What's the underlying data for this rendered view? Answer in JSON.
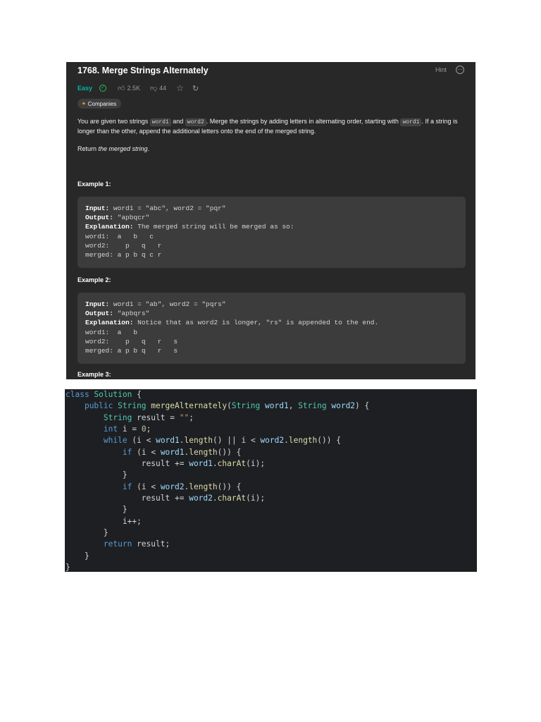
{
  "problem": {
    "title": "1768. Merge Strings Alternately",
    "hint": "Hint",
    "difficulty": "Easy",
    "likes": "2.5K",
    "dislikes": "44",
    "companies": "Companies",
    "desc_1": "You are given two strings ",
    "word1": "word1",
    "desc_2": " and ",
    "word2": "word2",
    "desc_3": ". Merge the strings by adding letters in alternating order, starting with ",
    "desc_4": ". If a string is longer than the other, append the additional letters onto the end of the merged string.",
    "return_prefix": "Return ",
    "return_em": "the merged string",
    "return_suffix": ".",
    "examples": [
      {
        "title": "Example 1:",
        "input_label": "Input:",
        "input": " word1 = \"abc\", word2 = \"pqr\"",
        "output_label": "Output:",
        "output": " \"apbqcr\"",
        "explanation_label": "Explanation:",
        "explanation": " The merged string will be merged as so:",
        "line1": "word1:  a   b   c",
        "line2": "word2:    p   q   r",
        "line3": "merged: a p b q c r"
      },
      {
        "title": "Example 2:",
        "input_label": "Input:",
        "input": " word1 = \"ab\", word2 = \"pqrs\"",
        "output_label": "Output:",
        "output": " \"apbqrs\"",
        "explanation_label": "Explanation:",
        "explanation": " Notice that as word2 is longer, \"rs\" is appended to the end.",
        "line1": "word1:  a   b",
        "line2": "word2:    p   q   r   s",
        "line3": "merged: a p b q   r   s"
      },
      {
        "title": "Example 3:"
      }
    ]
  },
  "code": {
    "language": "Java",
    "lines": [
      "class Solution {",
      "    public String mergeAlternately(String word1, String word2) {",
      "        String result = \"\";",
      "        int i = 0;",
      "        while (i < word1.length() || i < word2.length()) {",
      "            if (i < word1.length()) {",
      "                result += word1.charAt(i);",
      "            }",
      "            if (i < word2.length()) {",
      "                result += word2.charAt(i);",
      "            }",
      "            i++;",
      "        }",
      "        return result;",
      "    }",
      "}"
    ]
  },
  "colors": {
    "panel_bg": "#282828",
    "code_bg": "#1e1f22",
    "easy": "#00b8a3",
    "keyword": "#569cd6",
    "type": "#4ec9b0",
    "function": "#dcdcaa",
    "param": "#9cdcfe"
  },
  "icons": [
    "check-circle-icon",
    "thumbs-up-icon",
    "thumbs-down-icon",
    "star-icon",
    "share-icon",
    "lock-icon",
    "more-icon"
  ]
}
